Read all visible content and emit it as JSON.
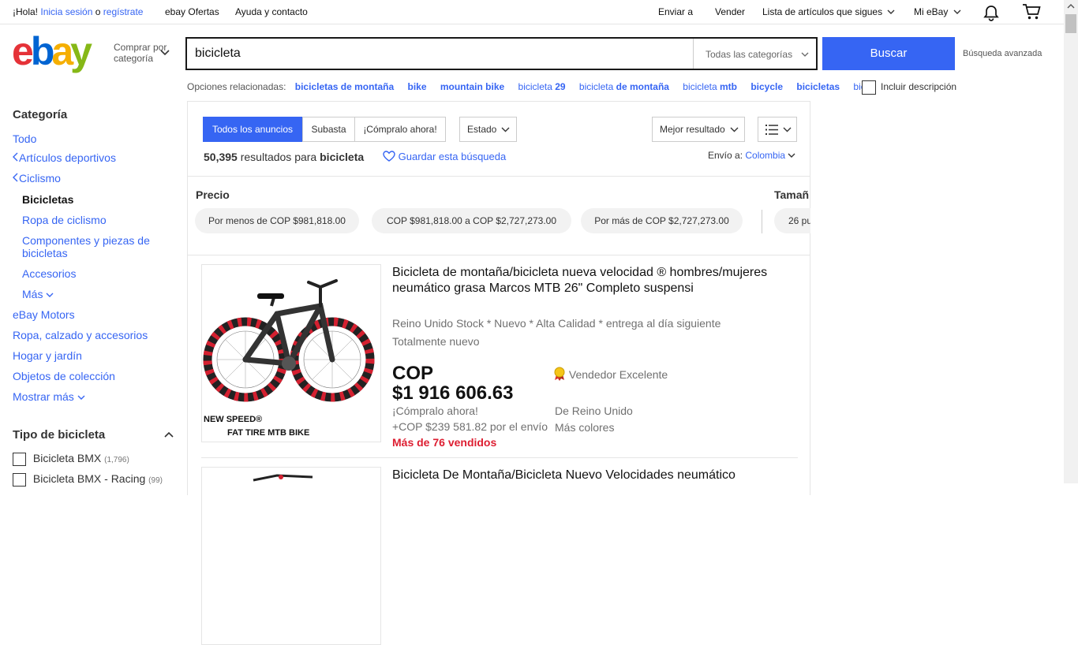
{
  "topbar": {
    "greeting": "¡Hola!",
    "signin": "Inicia sesión",
    "or": "o",
    "register": "regístrate",
    "deals": "ebay Ofertas",
    "help": "Ayuda y contacto",
    "ship": "Enviar a",
    "sell": "Vender",
    "watchlist": "Lista de artículos que sigues",
    "myebay": "Mi eBay"
  },
  "header": {
    "shop_by_category": "Comprar por\ncategoría",
    "search_value": "bicicleta",
    "category_select": "Todas las categorías",
    "search_button": "Buscar",
    "advanced": "Búsqueda avanzada"
  },
  "related": {
    "label": "Opciones relacionadas:",
    "items": [
      {
        "pre": "",
        "bold": "bicicletas de montaña"
      },
      {
        "pre": "",
        "bold": "bike"
      },
      {
        "pre": "",
        "bold": "mountain bike"
      },
      {
        "pre": "bicicleta ",
        "bold": "29"
      },
      {
        "pre": "bicicleta ",
        "bold": "de montaña"
      },
      {
        "pre": "bicicleta ",
        "bold": "mtb"
      },
      {
        "pre": "",
        "bold": "bicycle"
      },
      {
        "pre": "",
        "bold": "bicicletas"
      },
      {
        "pre": "bic…",
        "bold": ""
      }
    ],
    "include_description": "Incluir descripción"
  },
  "sidebar": {
    "category_heading": "Categoría",
    "all": "Todo",
    "sports": "Artículos deportivos",
    "cycling": "Ciclismo",
    "bicycles": "Bicicletas",
    "cycling_clothing": "Ropa de ciclismo",
    "components": "Componentes y piezas de bicicletas",
    "accessories": "Accesorios",
    "more": "Más",
    "motors": "eBay Motors",
    "clothing": "Ropa, calzado y accesorios",
    "home": "Hogar y jardín",
    "collectibles": "Objetos de colección",
    "show_more": "Mostrar más",
    "bike_type_heading": "Tipo de bicicleta",
    "bike_types": [
      {
        "label": "Bicicleta BMX",
        "count": "(1,796)"
      },
      {
        "label": "Bicicleta BMX - Racing",
        "count": "(99)"
      }
    ]
  },
  "results": {
    "tabs": [
      "Todos los anuncios",
      "Subasta",
      "¡Cómpralo ahora!"
    ],
    "status_dropdown": "Estado",
    "sort": "Mejor resultado",
    "count": "50,395",
    "results_for": "resultados para",
    "query": "bicicleta",
    "save_search": "Guardar esta búsqueda",
    "ship_to_label": "Envío a:",
    "ship_to_country": "Colombia",
    "price_heading": "Precio",
    "size_heading": "Tamañ",
    "price_pills": [
      "Por menos de COP $981,818.00",
      "COP $981,818.00 a COP $2,727,273.00",
      "Por más de COP $2,727,273.00"
    ],
    "size_pill": "26 pu"
  },
  "item1": {
    "title": "Bicicleta de montaña/bicicleta nueva velocidad ® hombres/mujeres neumático grasa Marcos MTB 26\" Completo suspensi",
    "subtitle": "Reino Unido Stock * Nuevo * Alta Calidad * entrega al día siguiente",
    "condition": "Totalmente nuevo",
    "price_currency": "COP",
    "price_value": "$1 916 606.63",
    "buy_now": "¡Cómpralo ahora!",
    "shipping": "+COP $239 581.82 por el envío",
    "sold": "Más de 76 vendidos",
    "seller": "Vendedor Excelente",
    "from": "De Reino Unido",
    "more_colors": "Más colores",
    "image_caption_1": "NEW SPEED®",
    "image_caption_2": "FAT TIRE MTB BIKE"
  },
  "item2": {
    "title": "Bicicleta De Montaña/Bicicleta Nuevo Velocidades neumático"
  }
}
